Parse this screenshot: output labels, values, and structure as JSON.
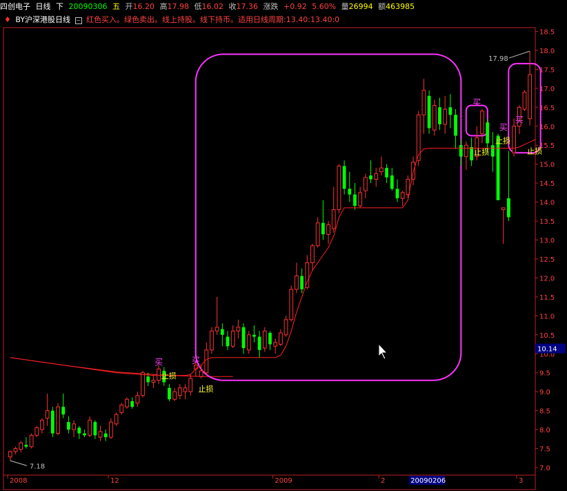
{
  "header": {
    "stock_name": "四创电子",
    "period": "日线",
    "direction": "下",
    "date": "20090306",
    "weekday": "五",
    "open_label": "开",
    "open": "16.20",
    "high_label": "高",
    "high": "17.98",
    "low_label": "低",
    "low": "16.02",
    "close_label": "收",
    "close": "17.36",
    "change_label": "涨跌",
    "change": "+0.92",
    "change_pct": "5.60%",
    "volume_label": "量",
    "volume": "26994",
    "amount_label": "额",
    "amount": "463985"
  },
  "indicator_bar": {
    "name": "BY沪深港股日线",
    "description": "红色买入。绿色卖出。线上持股。线下持币。适用日线周期:",
    "value1": "13.40",
    "value2": ":13.40",
    "value3": ":0"
  },
  "colors": {
    "up": "#ff3333",
    "down": "#00ff00",
    "axis": "#c02020",
    "axis_text": "#ff4040",
    "ma": "#ff2020",
    "highlight_box": "#ff33ff",
    "buy_text": "#ff44ff",
    "stop_text": "#ffff33",
    "price_tag_bg": "#000080"
  },
  "chart_data": {
    "type": "candlestick",
    "ylim": [
      6.8,
      18.6
    ],
    "y_ticks": [
      "7.0",
      "7.5",
      "8.0",
      "8.5",
      "9.0",
      "9.5",
      "10.0",
      "10.5",
      "11.0",
      "11.5",
      "12.0",
      "12.5",
      "13.0",
      "13.5",
      "14.0",
      "14.5",
      "15.0",
      "15.5",
      "16.0",
      "16.5",
      "17.0",
      "17.5",
      "18.0",
      "18.5"
    ],
    "x_labels": [
      {
        "label": "2008",
        "index": 0
      },
      {
        "label": "12",
        "index": 19
      },
      {
        "label": "2009",
        "index": 50
      },
      {
        "label": "2",
        "index": 70
      },
      {
        "label": "20090206",
        "index": 76
      },
      {
        "label": "3",
        "index": 96
      }
    ],
    "current_price_tag": "10.14",
    "annotations": {
      "low_value": "7.18",
      "high_value": "17.98",
      "buy_label": "买",
      "stop_label": "止损"
    },
    "ohlc": [
      [
        7.28,
        7.45,
        7.18,
        7.42
      ],
      [
        7.42,
        7.55,
        7.35,
        7.5
      ],
      [
        7.48,
        7.7,
        7.4,
        7.65
      ],
      [
        7.6,
        7.8,
        7.5,
        7.55
      ],
      [
        7.55,
        7.9,
        7.5,
        7.85
      ],
      [
        7.85,
        8.1,
        7.8,
        8.05
      ],
      [
        8.0,
        8.3,
        7.9,
        8.25
      ],
      [
        8.3,
        8.95,
        8.1,
        8.5
      ],
      [
        8.5,
        8.6,
        7.8,
        7.9
      ],
      [
        7.9,
        8.7,
        7.85,
        8.6
      ],
      [
        8.6,
        8.95,
        8.3,
        8.4
      ],
      [
        8.2,
        8.35,
        7.9,
        8.0
      ],
      [
        8.0,
        8.25,
        7.8,
        8.15
      ],
      [
        8.05,
        8.1,
        7.75,
        7.9
      ],
      [
        7.9,
        8.0,
        7.8,
        7.85
      ],
      [
        7.85,
        8.35,
        7.8,
        8.25
      ],
      [
        8.2,
        8.25,
        7.75,
        7.85
      ],
      [
        7.8,
        8.1,
        7.7,
        7.95
      ],
      [
        7.9,
        8.0,
        7.7,
        7.8
      ],
      [
        7.8,
        8.3,
        7.75,
        8.2
      ],
      [
        8.15,
        8.45,
        8.1,
        8.4
      ],
      [
        8.45,
        8.7,
        8.4,
        8.65
      ],
      [
        8.6,
        8.85,
        8.55,
        8.8
      ],
      [
        8.75,
        8.85,
        8.55,
        8.6
      ],
      [
        8.7,
        9.0,
        8.6,
        8.9
      ],
      [
        8.9,
        9.55,
        8.85,
        9.5
      ],
      [
        9.4,
        9.5,
        9.15,
        9.25
      ],
      [
        9.25,
        9.45,
        9.1,
        9.3
      ],
      [
        9.3,
        9.7,
        9.2,
        9.6
      ],
      [
        9.55,
        9.65,
        9.15,
        9.25
      ],
      [
        9.1,
        9.2,
        8.75,
        8.8
      ],
      [
        8.8,
        9.1,
        8.75,
        9.0
      ],
      [
        8.9,
        9.2,
        8.8,
        9.1
      ],
      [
        9.0,
        9.2,
        8.8,
        9.1
      ],
      [
        9.0,
        9.45,
        8.9,
        9.35
      ],
      [
        9.6,
        9.8,
        9.4,
        9.7
      ],
      [
        9.4,
        9.7,
        9.35,
        9.55
      ],
      [
        9.5,
        10.3,
        9.45,
        10.1
      ],
      [
        10.1,
        10.7,
        10.0,
        10.6
      ],
      [
        10.6,
        11.5,
        10.5,
        10.7
      ],
      [
        10.65,
        10.8,
        10.2,
        10.5
      ],
      [
        10.45,
        10.6,
        10.1,
        10.2
      ],
      [
        10.2,
        10.75,
        10.15,
        10.6
      ],
      [
        10.6,
        10.9,
        10.4,
        10.7
      ],
      [
        10.7,
        10.8,
        10.0,
        10.15
      ],
      [
        10.1,
        10.6,
        10.0,
        10.5
      ],
      [
        10.5,
        10.75,
        10.3,
        10.45
      ],
      [
        10.45,
        10.6,
        9.9,
        10.1
      ],
      [
        10.15,
        10.7,
        10.05,
        10.6
      ],
      [
        10.55,
        10.6,
        10.1,
        10.25
      ],
      [
        10.2,
        10.4,
        10.0,
        10.3
      ],
      [
        10.25,
        10.65,
        10.2,
        10.55
      ],
      [
        10.5,
        11.0,
        10.45,
        10.9
      ],
      [
        10.9,
        11.8,
        10.85,
        11.7
      ],
      [
        11.7,
        12.4,
        11.6,
        12.05
      ],
      [
        12.05,
        12.25,
        11.6,
        11.7
      ],
      [
        11.75,
        12.6,
        11.7,
        12.4
      ],
      [
        12.4,
        12.9,
        12.2,
        12.85
      ],
      [
        12.85,
        13.6,
        12.8,
        13.45
      ],
      [
        13.45,
        14.05,
        13.0,
        13.15
      ],
      [
        13.15,
        13.5,
        12.9,
        13.4
      ],
      [
        13.3,
        14.4,
        13.2,
        13.8
      ],
      [
        13.8,
        15.0,
        13.7,
        14.95
      ],
      [
        14.95,
        15.1,
        14.2,
        14.35
      ],
      [
        14.35,
        14.8,
        14.0,
        14.2
      ],
      [
        14.2,
        14.5,
        13.8,
        13.9
      ],
      [
        13.9,
        14.4,
        13.85,
        14.25
      ],
      [
        14.3,
        14.75,
        14.1,
        14.65
      ],
      [
        14.7,
        15.1,
        14.5,
        14.6
      ],
      [
        14.6,
        14.9,
        14.4,
        14.75
      ],
      [
        14.8,
        15.2,
        14.7,
        14.9
      ],
      [
        14.9,
        15.0,
        14.5,
        14.65
      ],
      [
        14.7,
        14.9,
        14.3,
        14.35
      ],
      [
        14.35,
        14.6,
        14.0,
        14.1
      ],
      [
        14.1,
        14.3,
        13.9,
        14.25
      ],
      [
        14.2,
        14.7,
        14.1,
        14.6
      ],
      [
        14.6,
        15.2,
        14.45,
        15.05
      ],
      [
        15.1,
        16.4,
        14.95,
        16.3
      ],
      [
        16.3,
        17.25,
        15.8,
        16.95
      ],
      [
        16.8,
        16.95,
        15.8,
        15.95
      ],
      [
        15.9,
        16.7,
        15.75,
        16.55
      ],
      [
        16.5,
        16.75,
        15.9,
        16.05
      ],
      [
        16.05,
        16.8,
        15.8,
        16.45
      ],
      [
        16.5,
        16.85,
        15.95,
        16.3
      ],
      [
        16.3,
        16.45,
        15.4,
        15.75
      ],
      [
        15.5,
        15.65,
        14.95,
        15.2
      ],
      [
        15.2,
        15.6,
        14.85,
        15.5
      ],
      [
        15.45,
        15.7,
        14.95,
        15.1
      ],
      [
        15.2,
        16.0,
        15.1,
        15.7
      ],
      [
        15.8,
        16.45,
        15.55,
        16.4
      ],
      [
        16.1,
        16.2,
        15.3,
        15.55
      ],
      [
        15.5,
        15.85,
        14.8,
        15.2
      ],
      [
        15.75,
        15.8,
        14.25,
        14.05
      ],
      [
        13.8,
        13.85,
        12.9,
        13.85
      ],
      [
        14.1,
        15.35,
        13.5,
        13.6
      ],
      [
        15.3,
        16.2,
        15.2,
        16.0
      ],
      [
        16.0,
        16.55,
        15.8,
        16.5
      ],
      [
        16.45,
        16.95,
        16.4,
        16.9
      ],
      [
        16.2,
        17.98,
        16.02,
        17.36
      ]
    ],
    "ma_line": [
      9.9,
      9.88,
      9.86,
      9.84,
      9.82,
      9.8,
      9.78,
      9.76,
      9.74,
      9.72,
      9.7,
      9.68,
      9.66,
      9.64,
      9.62,
      9.6,
      9.58,
      9.56,
      9.54,
      9.52,
      9.5,
      9.49,
      9.48,
      9.47,
      9.46,
      9.45,
      9.44,
      9.43,
      9.43,
      9.43,
      9.43,
      9.43,
      9.43,
      9.43,
      9.45,
      9.6,
      9.7,
      9.85,
      9.9,
      9.9,
      9.9,
      9.9,
      9.9,
      9.9,
      9.9,
      9.9,
      9.9,
      9.9,
      9.9,
      9.9,
      9.9,
      9.96,
      10.2,
      10.6,
      11.1,
      11.5,
      11.9,
      12.2,
      12.4,
      12.6,
      12.8,
      13.1,
      13.6,
      13.85,
      13.85,
      13.85,
      13.85,
      13.85,
      13.85,
      13.85,
      13.85,
      13.85,
      13.85,
      13.85,
      13.85,
      14.05,
      14.8,
      15.25,
      15.4,
      15.42,
      15.42,
      15.42,
      15.42,
      15.42,
      15.42,
      15.42,
      15.42,
      15.42,
      15.42,
      15.42,
      15.42,
      15.42,
      15.42,
      15.42,
      15.42,
      15.42,
      15.45,
      15.52,
      15.58,
      15.65
    ],
    "long_ma": [
      [
        0,
        9.9
      ],
      [
        10,
        9.7
      ],
      [
        20,
        9.52
      ],
      [
        30,
        9.43
      ],
      [
        36,
        9.4
      ],
      [
        42,
        9.4
      ]
    ],
    "highlight_boxes": [
      {
        "start": 36,
        "end": 84,
        "ylow": 9.3,
        "yhigh": 17.9
      },
      {
        "start": 87,
        "end": 89,
        "ylow": 15.75,
        "yhigh": 16.55
      },
      {
        "start": 95,
        "end": 99,
        "ylow": 15.3,
        "yhigh": 17.65
      }
    ],
    "buy_marks": [
      {
        "i": 28,
        "y": 9.7
      },
      {
        "i": 35,
        "y": 9.75
      },
      {
        "i": 88,
        "y": 16.55
      },
      {
        "i": 96,
        "y": 16.1
      },
      {
        "i": 93,
        "y": 15.9
      }
    ],
    "stop_marks": [
      {
        "i": 29,
        "y": 9.35
      },
      {
        "i": 36,
        "y": 9.0
      },
      {
        "i": 88,
        "y": 15.25
      },
      {
        "i": 92,
        "y": 15.55
      },
      {
        "i": 98,
        "y": 15.28
      }
    ]
  }
}
